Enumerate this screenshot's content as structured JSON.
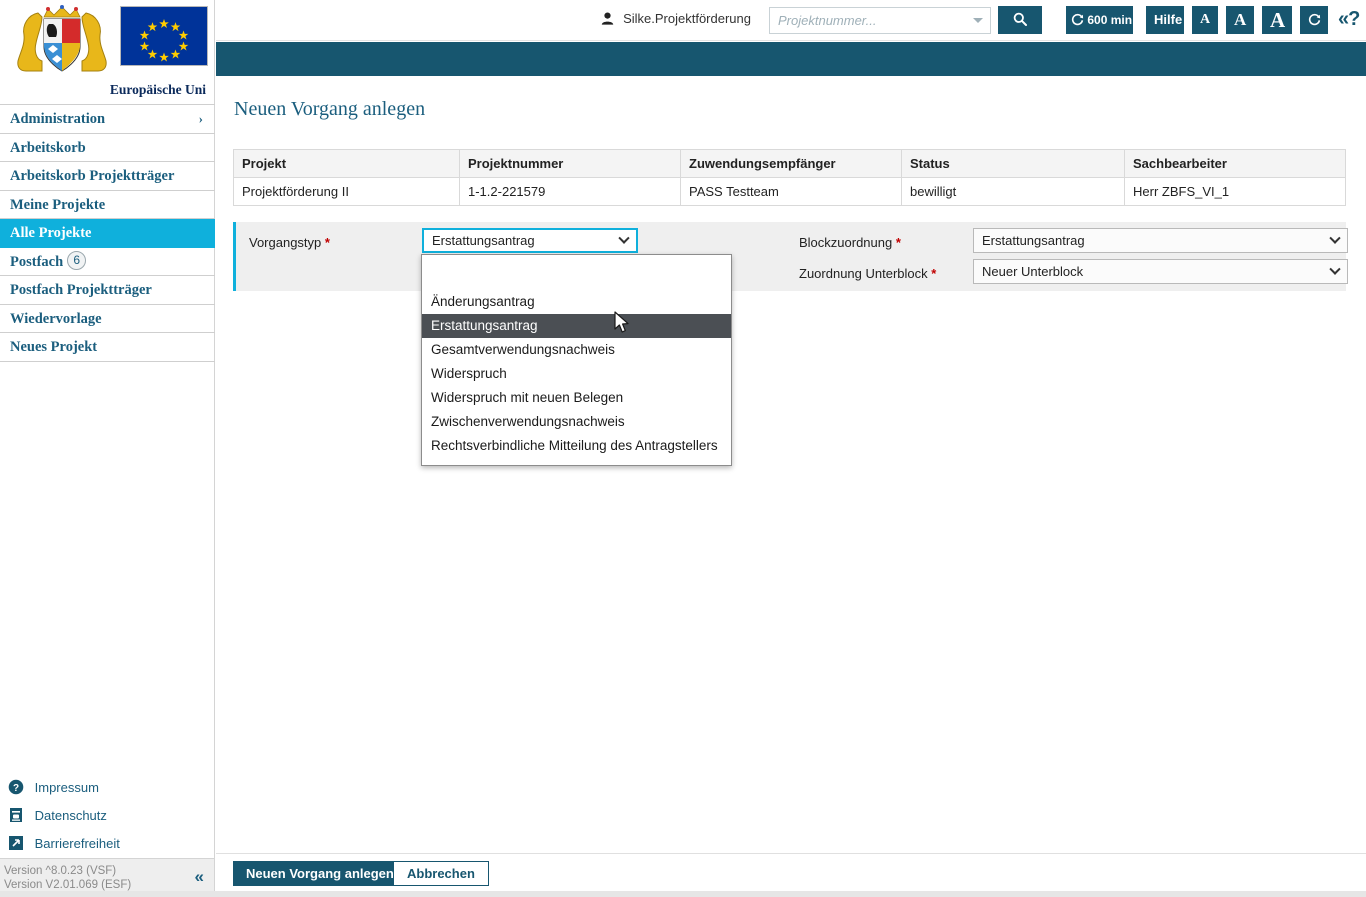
{
  "topbar": {
    "user": "Silke.Projektförderung",
    "user_icon": "user-icon",
    "search_placeholder": "Projektnummer...",
    "search_value": "",
    "search_button_icon": "search-icon",
    "session_label": "600 min",
    "session_icon": "refresh-icon",
    "help_label": "Hilfe",
    "font_small": "A",
    "font_medium": "A",
    "font_large": "A",
    "reload_icon": "refresh-icon",
    "help_toggle": "«?",
    "accent_color": "#17566f"
  },
  "sidebar": {
    "eu_caption": "Europäische Uni",
    "crest_alt": "bavaria-coat-of-arms",
    "flag_alt": "eu-flag",
    "active_color": "#0fb0dc",
    "items": [
      {
        "label": "Administration",
        "chevron": "›",
        "active": false,
        "badge": null
      },
      {
        "label": "Arbeitskorb",
        "chevron": null,
        "active": false,
        "badge": null
      },
      {
        "label": "Arbeitskorb Projektträger",
        "chevron": null,
        "active": false,
        "badge": null
      },
      {
        "label": "Meine Projekte",
        "chevron": null,
        "active": false,
        "badge": null
      },
      {
        "label": "Alle Projekte",
        "chevron": null,
        "active": true,
        "badge": null
      },
      {
        "label": "Postfach",
        "chevron": null,
        "active": false,
        "badge": "6"
      },
      {
        "label": "Postfach Projektträger",
        "chevron": null,
        "active": false,
        "badge": null
      },
      {
        "label": "Wiedervorlage",
        "chevron": null,
        "active": false,
        "badge": null
      },
      {
        "label": "Neues Projekt",
        "chevron": null,
        "active": false,
        "badge": null
      }
    ],
    "footer_links": [
      {
        "label": "Impressum",
        "icon": "question-circle-icon"
      },
      {
        "label": "Datenschutz",
        "icon": "document-lock-icon"
      },
      {
        "label": "Barrierefreiheit",
        "icon": "arrow-diagonal-icon"
      }
    ],
    "version_line1": "Version ^8.0.23 (VSF)",
    "version_line2": "Version V2.01.069 (ESF)",
    "collapse_icon": "«"
  },
  "main": {
    "page_title": "Neuen Vorgang anlegen",
    "table": {
      "headers": [
        "Projekt",
        "Projektnummer",
        "Zuwendungsempfänger",
        "Status",
        "Sachbearbeiter"
      ],
      "rows": [
        [
          "Projektförderung II",
          "1-1.2-221579",
          "PASS Testteam",
          "bewilligt",
          "Herr ZBFS_VI_1"
        ]
      ]
    },
    "form": {
      "vorgangstyp_label": "Vorgangstyp",
      "vorgangstyp_value": "Erstattungsantrag",
      "vorgangstyp_options": [
        "",
        "Änderungsantrag",
        "Erstattungsantrag",
        "Gesamtverwendungsnachweis",
        "Widerspruch",
        "Widerspruch mit neuen Belegen",
        "Zwischenverwendungsnachweis",
        "Rechtsverbindliche Mitteilung des Antragstellers"
      ],
      "vorgangstyp_selected_index": 2,
      "blockzuordnung_label": "Blockzuordnung",
      "blockzuordnung_value": "Erstattungsantrag",
      "unterblock_label": "Zuordnung Unterblock",
      "unterblock_value": "Neuer Unterblock",
      "required_marker": "*"
    }
  },
  "actions": {
    "primary_label": "Neuen Vorgang anlegen",
    "secondary_label": "Abbrechen"
  }
}
